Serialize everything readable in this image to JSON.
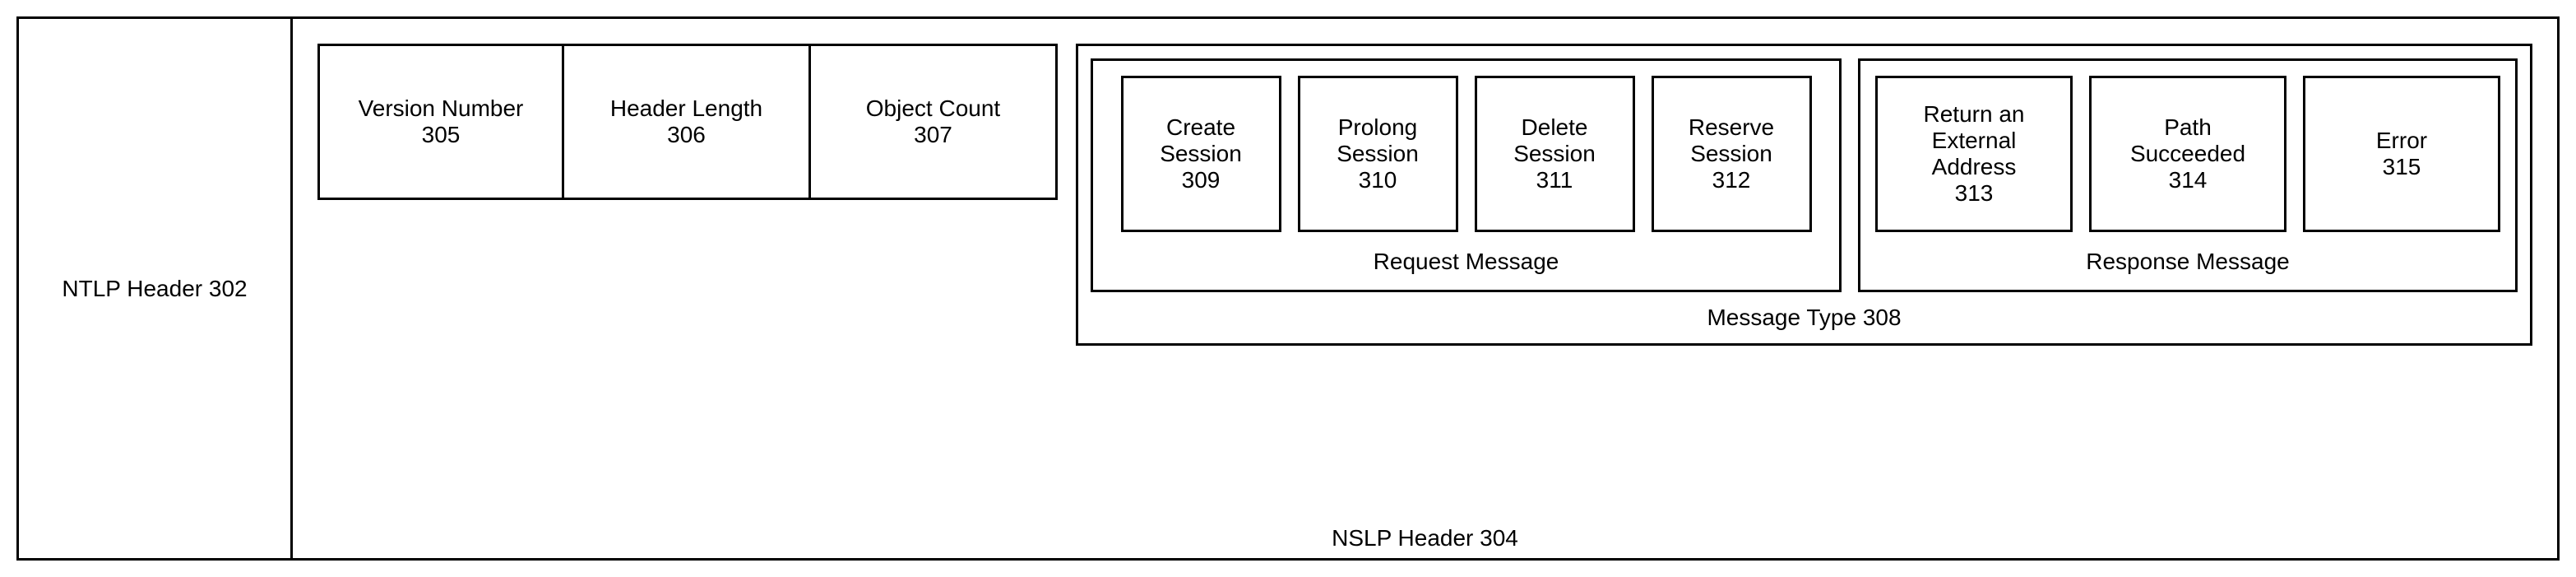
{
  "ntlp": {
    "label": "NTLP Header 302"
  },
  "nslp": {
    "label": "NSLP Header 304",
    "fields": {
      "version": {
        "title": "Version Number",
        "num": "305"
      },
      "hlen": {
        "title": "Header Length",
        "num": "306"
      },
      "ocount": {
        "title": "Object Count",
        "num": "307"
      }
    },
    "message_type": {
      "label": "Message Type 308",
      "request": {
        "label": "Request Message",
        "items": {
          "create": {
            "l1": "Create",
            "l2": "Session",
            "num": "309"
          },
          "prolong": {
            "l1": "Prolong",
            "l2": "Session",
            "num": "310"
          },
          "delete": {
            "l1": "Delete",
            "l2": "Session",
            "num": "311"
          },
          "reserve": {
            "l1": "Reserve",
            "l2": "Session",
            "num": "312"
          }
        }
      },
      "response": {
        "label": "Response Message",
        "items": {
          "ret_ext": {
            "l1": "Return an",
            "l2": "External",
            "l3": "Address",
            "num": "313"
          },
          "path_ok": {
            "l1": "Path",
            "l2": "Succeeded",
            "num": "314"
          },
          "error": {
            "l1": "Error",
            "num": "315"
          }
        }
      }
    }
  }
}
